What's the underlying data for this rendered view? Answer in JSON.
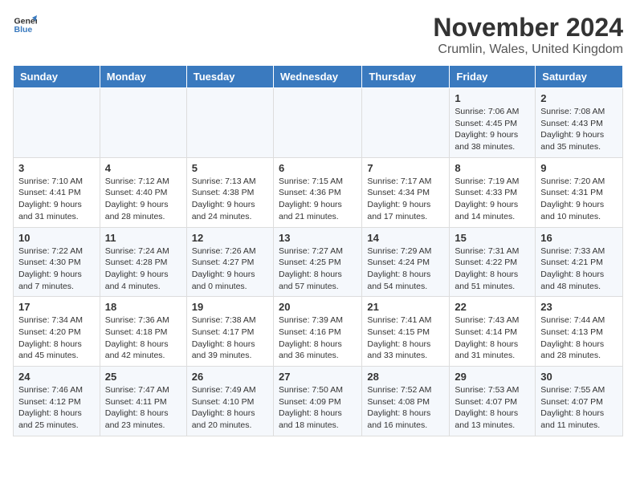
{
  "logo": {
    "general": "General",
    "blue": "Blue"
  },
  "title": "November 2024",
  "location": "Crumlin, Wales, United Kingdom",
  "days_of_week": [
    "Sunday",
    "Monday",
    "Tuesday",
    "Wednesday",
    "Thursday",
    "Friday",
    "Saturday"
  ],
  "weeks": [
    [
      {
        "day": "",
        "info": ""
      },
      {
        "day": "",
        "info": ""
      },
      {
        "day": "",
        "info": ""
      },
      {
        "day": "",
        "info": ""
      },
      {
        "day": "",
        "info": ""
      },
      {
        "day": "1",
        "info": "Sunrise: 7:06 AM\nSunset: 4:45 PM\nDaylight: 9 hours\nand 38 minutes."
      },
      {
        "day": "2",
        "info": "Sunrise: 7:08 AM\nSunset: 4:43 PM\nDaylight: 9 hours\nand 35 minutes."
      }
    ],
    [
      {
        "day": "3",
        "info": "Sunrise: 7:10 AM\nSunset: 4:41 PM\nDaylight: 9 hours\nand 31 minutes."
      },
      {
        "day": "4",
        "info": "Sunrise: 7:12 AM\nSunset: 4:40 PM\nDaylight: 9 hours\nand 28 minutes."
      },
      {
        "day": "5",
        "info": "Sunrise: 7:13 AM\nSunset: 4:38 PM\nDaylight: 9 hours\nand 24 minutes."
      },
      {
        "day": "6",
        "info": "Sunrise: 7:15 AM\nSunset: 4:36 PM\nDaylight: 9 hours\nand 21 minutes."
      },
      {
        "day": "7",
        "info": "Sunrise: 7:17 AM\nSunset: 4:34 PM\nDaylight: 9 hours\nand 17 minutes."
      },
      {
        "day": "8",
        "info": "Sunrise: 7:19 AM\nSunset: 4:33 PM\nDaylight: 9 hours\nand 14 minutes."
      },
      {
        "day": "9",
        "info": "Sunrise: 7:20 AM\nSunset: 4:31 PM\nDaylight: 9 hours\nand 10 minutes."
      }
    ],
    [
      {
        "day": "10",
        "info": "Sunrise: 7:22 AM\nSunset: 4:30 PM\nDaylight: 9 hours\nand 7 minutes."
      },
      {
        "day": "11",
        "info": "Sunrise: 7:24 AM\nSunset: 4:28 PM\nDaylight: 9 hours\nand 4 minutes."
      },
      {
        "day": "12",
        "info": "Sunrise: 7:26 AM\nSunset: 4:27 PM\nDaylight: 9 hours\nand 0 minutes."
      },
      {
        "day": "13",
        "info": "Sunrise: 7:27 AM\nSunset: 4:25 PM\nDaylight: 8 hours\nand 57 minutes."
      },
      {
        "day": "14",
        "info": "Sunrise: 7:29 AM\nSunset: 4:24 PM\nDaylight: 8 hours\nand 54 minutes."
      },
      {
        "day": "15",
        "info": "Sunrise: 7:31 AM\nSunset: 4:22 PM\nDaylight: 8 hours\nand 51 minutes."
      },
      {
        "day": "16",
        "info": "Sunrise: 7:33 AM\nSunset: 4:21 PM\nDaylight: 8 hours\nand 48 minutes."
      }
    ],
    [
      {
        "day": "17",
        "info": "Sunrise: 7:34 AM\nSunset: 4:20 PM\nDaylight: 8 hours\nand 45 minutes."
      },
      {
        "day": "18",
        "info": "Sunrise: 7:36 AM\nSunset: 4:18 PM\nDaylight: 8 hours\nand 42 minutes."
      },
      {
        "day": "19",
        "info": "Sunrise: 7:38 AM\nSunset: 4:17 PM\nDaylight: 8 hours\nand 39 minutes."
      },
      {
        "day": "20",
        "info": "Sunrise: 7:39 AM\nSunset: 4:16 PM\nDaylight: 8 hours\nand 36 minutes."
      },
      {
        "day": "21",
        "info": "Sunrise: 7:41 AM\nSunset: 4:15 PM\nDaylight: 8 hours\nand 33 minutes."
      },
      {
        "day": "22",
        "info": "Sunrise: 7:43 AM\nSunset: 4:14 PM\nDaylight: 8 hours\nand 31 minutes."
      },
      {
        "day": "23",
        "info": "Sunrise: 7:44 AM\nSunset: 4:13 PM\nDaylight: 8 hours\nand 28 minutes."
      }
    ],
    [
      {
        "day": "24",
        "info": "Sunrise: 7:46 AM\nSunset: 4:12 PM\nDaylight: 8 hours\nand 25 minutes."
      },
      {
        "day": "25",
        "info": "Sunrise: 7:47 AM\nSunset: 4:11 PM\nDaylight: 8 hours\nand 23 minutes."
      },
      {
        "day": "26",
        "info": "Sunrise: 7:49 AM\nSunset: 4:10 PM\nDaylight: 8 hours\nand 20 minutes."
      },
      {
        "day": "27",
        "info": "Sunrise: 7:50 AM\nSunset: 4:09 PM\nDaylight: 8 hours\nand 18 minutes."
      },
      {
        "day": "28",
        "info": "Sunrise: 7:52 AM\nSunset: 4:08 PM\nDaylight: 8 hours\nand 16 minutes."
      },
      {
        "day": "29",
        "info": "Sunrise: 7:53 AM\nSunset: 4:07 PM\nDaylight: 8 hours\nand 13 minutes."
      },
      {
        "day": "30",
        "info": "Sunrise: 7:55 AM\nSunset: 4:07 PM\nDaylight: 8 hours\nand 11 minutes."
      }
    ]
  ]
}
